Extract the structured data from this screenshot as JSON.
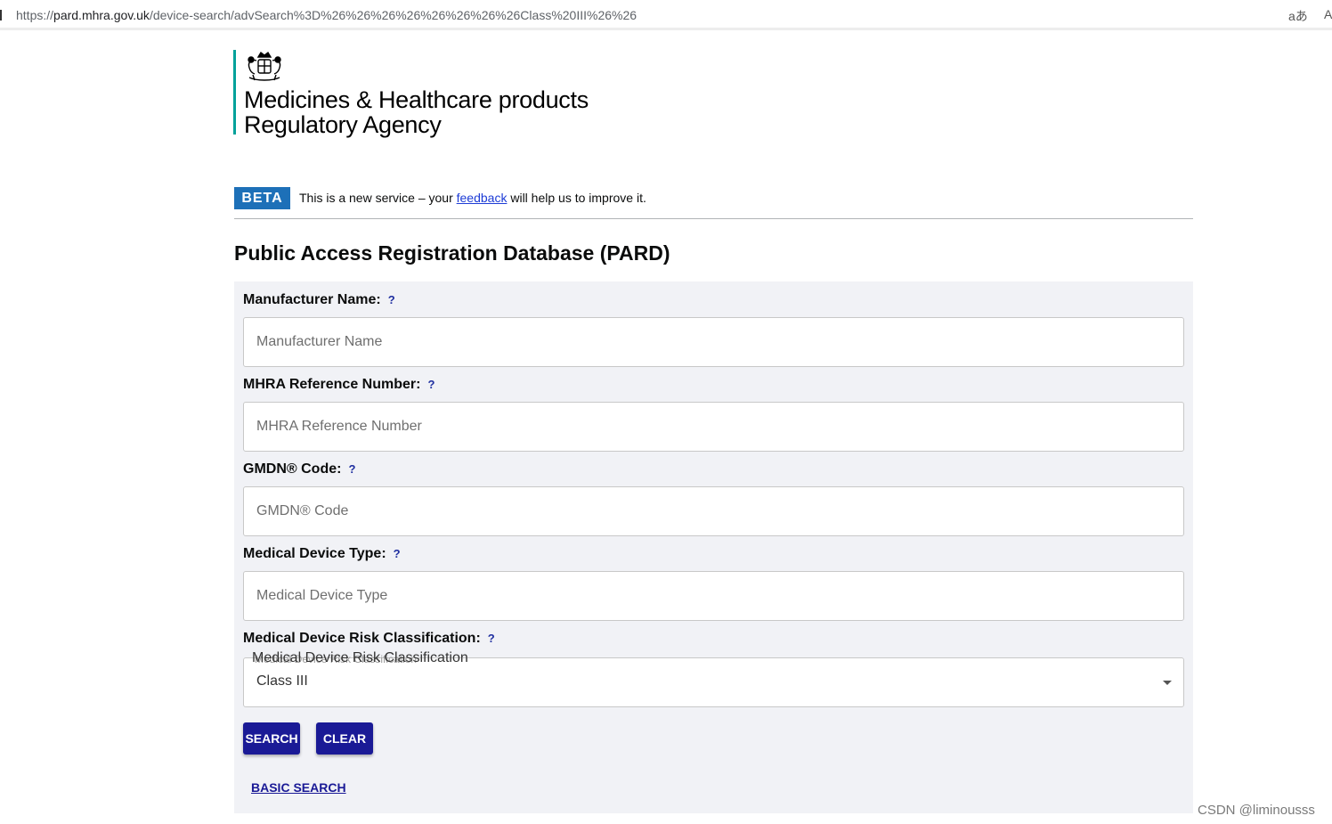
{
  "browser": {
    "url_scheme": "https://",
    "url_host": "pard.mhra.gov.uk",
    "url_path": "/device-search/advSearch%3D%26%26%26%26%26%26%26%26Class%20III%26%26",
    "read_aloud_label": "aあ",
    "text_size_label": "A"
  },
  "header": {
    "agency_line1": "Medicines & Healthcare products",
    "agency_line2": "Regulatory Agency"
  },
  "beta": {
    "tag": "BETA",
    "text_before": "This is a new service – your ",
    "link": "feedback",
    "text_after": " will help us to improve it."
  },
  "page": {
    "title": "Public Access Registration Database (PARD)"
  },
  "form": {
    "help_symbol": "?",
    "manufacturer": {
      "label": "Manufacturer Name:",
      "placeholder": "Manufacturer Name",
      "value": ""
    },
    "reference": {
      "label": "MHRA Reference Number:",
      "placeholder": "MHRA Reference Number",
      "value": ""
    },
    "gmdn": {
      "label": "GMDN® Code:",
      "placeholder": "GMDN® Code",
      "value": ""
    },
    "device_type": {
      "label": "Medical Device Type:",
      "placeholder": "Medical Device Type",
      "value": ""
    },
    "risk": {
      "label": "Medical Device Risk Classification:",
      "float_label": "Medical Device Risk Classification",
      "value": "Class III"
    },
    "search_button": "SEARCH",
    "clear_button": "CLEAR",
    "basic_search_link": "BASIC SEARCH"
  },
  "watermark": "CSDN @liminousss",
  "colors": {
    "accent_teal": "#00a19a",
    "beta_blue": "#1d70b8",
    "button_navy": "#1a1a96",
    "panel_bg": "#f1f2f6"
  }
}
